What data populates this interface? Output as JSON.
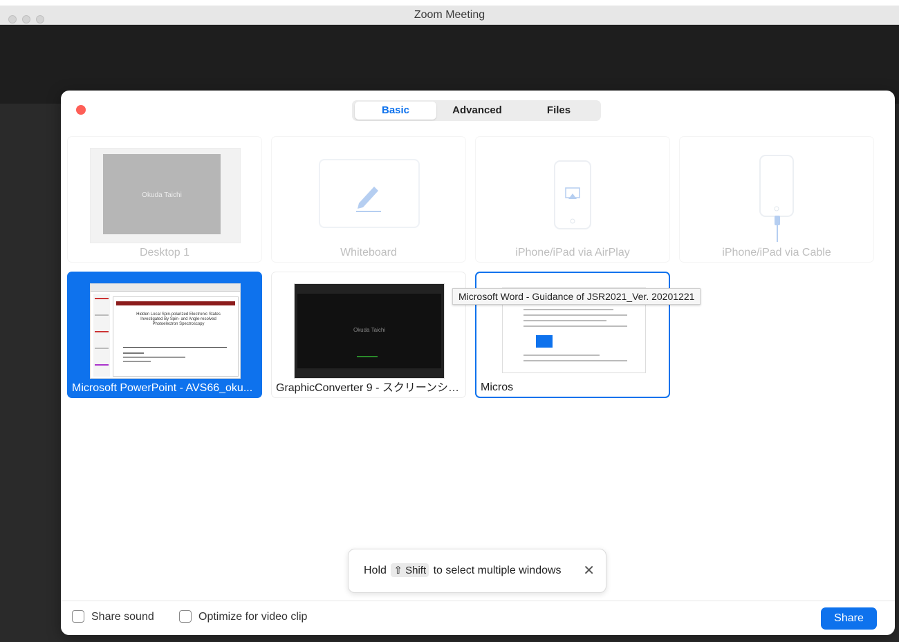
{
  "window": {
    "title": "Zoom Meeting"
  },
  "tabs": [
    {
      "label": "Basic"
    },
    {
      "label": "Advanced"
    },
    {
      "label": "Files"
    }
  ],
  "cards": {
    "desktop": {
      "label": "Desktop 1",
      "thumb_name": "Okuda Taichi"
    },
    "whiteboard": {
      "label": "Whiteboard"
    },
    "airplay": {
      "label": "iPhone/iPad via AirPlay"
    },
    "cable": {
      "label": "iPhone/iPad via Cable"
    },
    "powerpoint": {
      "label": "Microsoft PowerPoint - AVS66_oku...",
      "slide_title": "Hidden Local Spin-polarized Electronic States Investigated By Spin- and Angle-resolved Photoelectron Spectroscopy"
    },
    "graphicconverter": {
      "label": "GraphicConverter 9 - スクリーンシ…",
      "thumb_name": "Okuda Taichi"
    },
    "word": {
      "label": "Micros"
    }
  },
  "tooltip": "Microsoft Word - Guidance of JSR2021_Ver. 20201221",
  "toast": {
    "hold": "Hold",
    "key": "⇧ Shift",
    "rest": "to select multiple windows",
    "close": "✕"
  },
  "footer": {
    "share_sound": "Share sound",
    "optimize": "Optimize for video clip",
    "share_button": "Share"
  },
  "colors": {
    "accent": "#0e72ed",
    "close_red": "#fe5f57"
  }
}
